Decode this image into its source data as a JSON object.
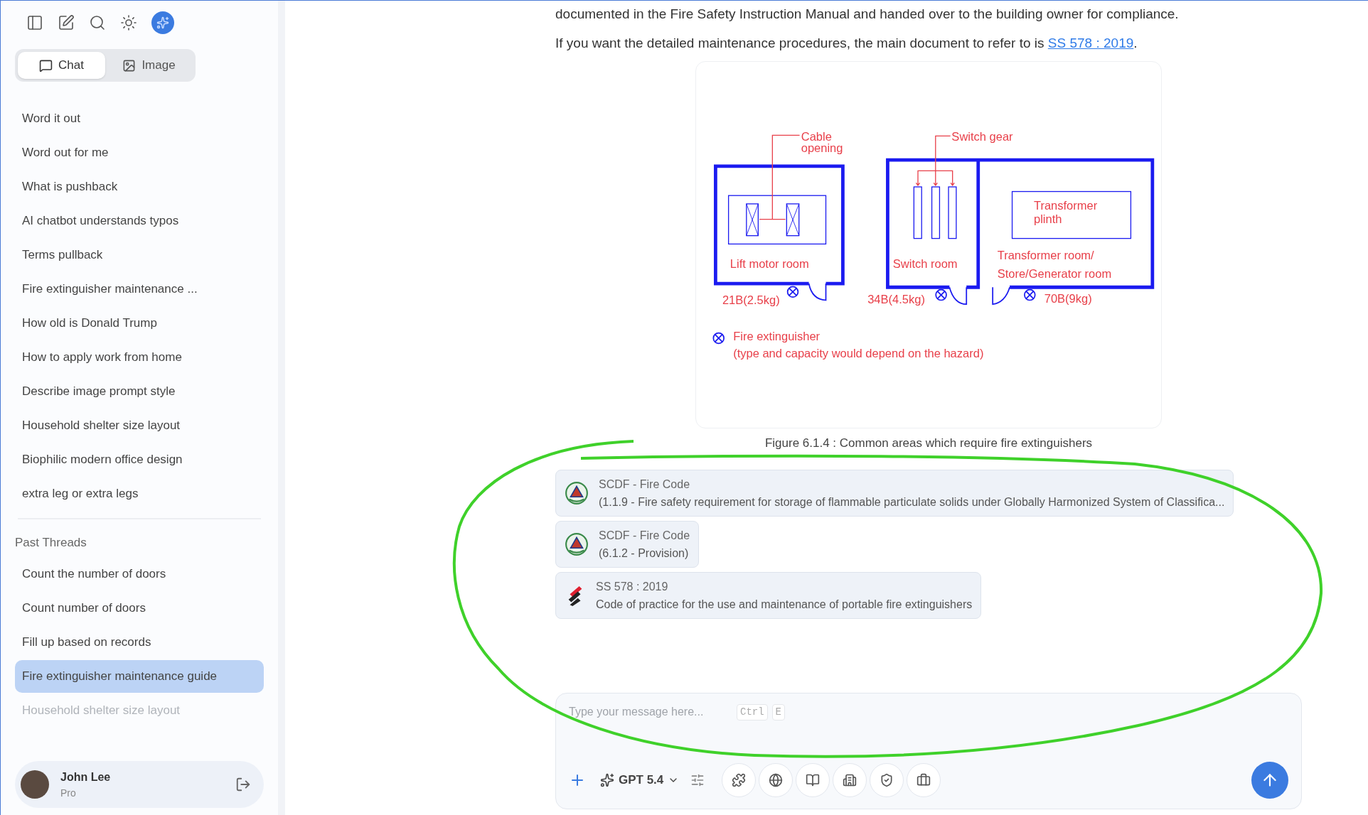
{
  "sidebar": {
    "mode_tabs": [
      {
        "label": "Chat",
        "selected": true
      },
      {
        "label": "Image",
        "selected": false
      }
    ],
    "recent": [
      {
        "label": "Word it out"
      },
      {
        "label": "Word out for me"
      },
      {
        "label": "What is pushback"
      },
      {
        "label": "AI chatbot understands typos"
      },
      {
        "label": "Terms pullback"
      },
      {
        "label": "Fire extinguisher maintenance ..."
      },
      {
        "label": "How old is Donald Trump"
      },
      {
        "label": "How to apply work from home"
      },
      {
        "label": "Describe image prompt style"
      },
      {
        "label": "Household shelter size layout"
      },
      {
        "label": "Biophilic modern office design"
      },
      {
        "label": "extra leg or extra legs"
      }
    ],
    "past_threads_heading": "Past Threads",
    "past_threads": [
      {
        "label": "Count the number of doors",
        "selected": false,
        "faded": false
      },
      {
        "label": "Count number of doors",
        "selected": false,
        "faded": false
      },
      {
        "label": "Fill up based on records",
        "selected": false,
        "faded": false
      },
      {
        "label": "Fire extinguisher maintenance guide",
        "selected": true,
        "faded": false
      },
      {
        "label": "Household shelter size layout",
        "selected": false,
        "faded": true
      }
    ],
    "user": {
      "name": "John Lee",
      "plan": "Pro"
    }
  },
  "message": {
    "paragraph": "documented in the Fire Safety Instruction Manual and handed over to the building owner for compliance.",
    "reference": {
      "text": "If you want the detailed maintenance procedures, the main document to refer to is ",
      "link": "SS 578 : 2019",
      "after": "."
    },
    "figure": {
      "cable_label_1": "Cable",
      "cable_label_2": "opening",
      "switch_gear_label": "Switch gear",
      "lift_room": "Lift motor room",
      "switch_room": "Switch room",
      "plinth_1": "Transformer",
      "plinth_2": "plinth",
      "transformer_room_1": "Transformer room/",
      "transformer_room_2": "Store/Generator room",
      "rating_lift": "21B(2.5kg)",
      "rating_switch": "34B(4.5kg)",
      "rating_transformer": "70B(9kg)",
      "legend_1": "Fire extinguisher",
      "legend_2": "(type and capacity would depend on the hazard)"
    },
    "caption": "Figure 6.1.4 : Common areas which require fire extinguishers",
    "sources": [
      {
        "kind": "scdf",
        "title": "SCDF - Fire Code",
        "detail": "(1.1.9 - Fire safety requirement for storage of flammable particulate solids under Globally Harmonized System of Classifica..."
      },
      {
        "kind": "scdf",
        "title": "SCDF - Fire Code",
        "detail": "(6.1.2 - Provision)"
      },
      {
        "kind": "ss",
        "title": "SS 578 : 2019",
        "detail": "Code of practice for the use and maintenance of portable fire extinguishers"
      }
    ]
  },
  "composer": {
    "placeholder": "Type your message here...",
    "shortcut": [
      "Ctrl",
      "E"
    ],
    "model": "GPT 5.4"
  }
}
